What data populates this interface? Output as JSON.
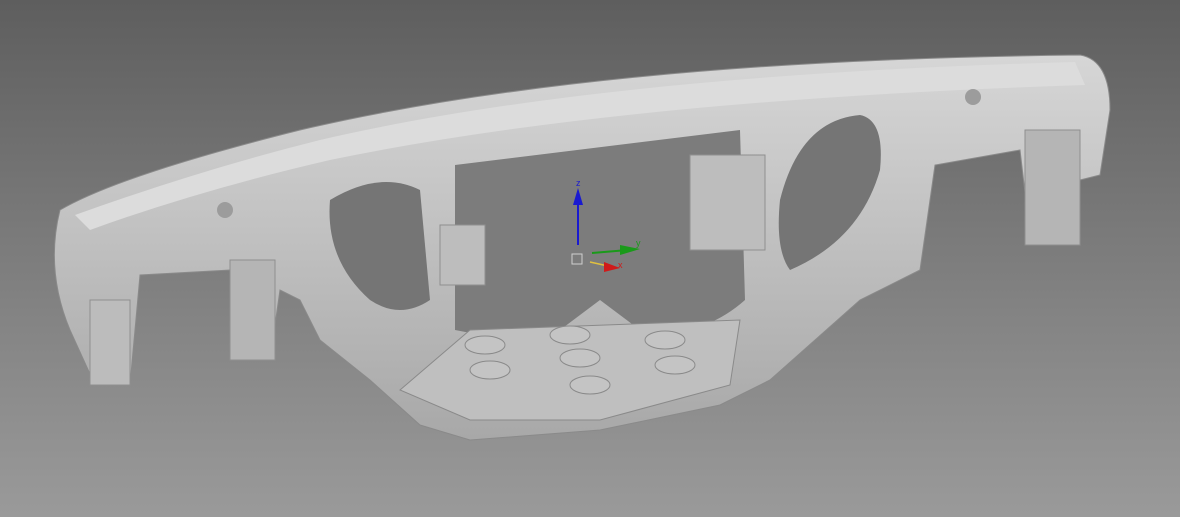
{
  "viewport": {
    "background_top": "#5e5e5e",
    "background_bottom": "#9a9a9a",
    "model_color": "#c8c8c8"
  },
  "gizmo": {
    "z_label": "z",
    "y_label": "y",
    "x_label": "x",
    "z_color": "#1a1ad0",
    "y_color": "#1a9a1a",
    "x_color": "#d01a1a"
  }
}
